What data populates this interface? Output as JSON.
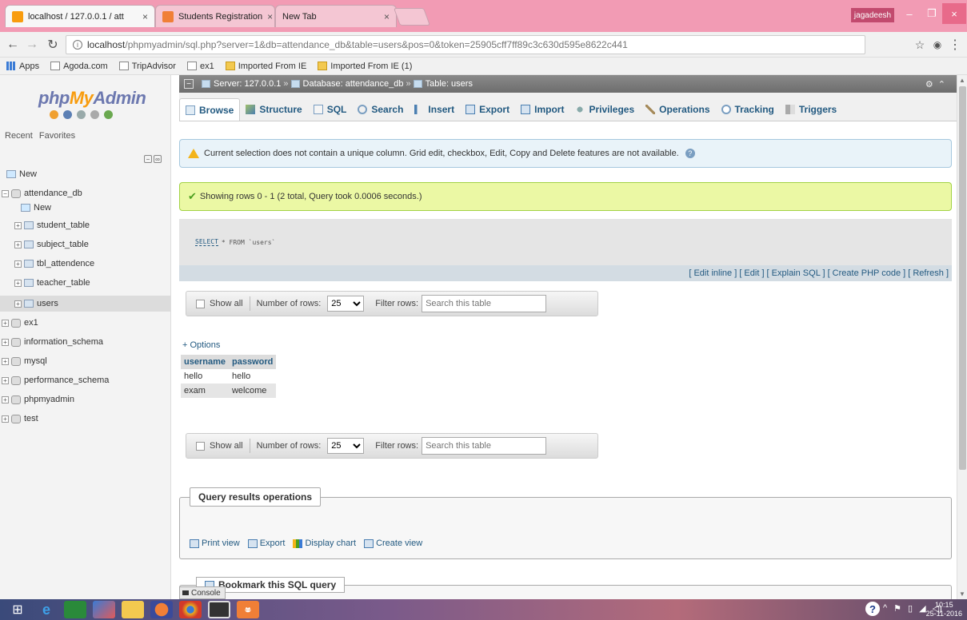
{
  "browser": {
    "tabs": [
      {
        "label": "localhost / 127.0.0.1 / att",
        "close": "×"
      },
      {
        "label": "Students Registration",
        "close": "×"
      },
      {
        "label": "New Tab",
        "close": "×"
      }
    ],
    "user": "jagadeesh",
    "window_controls": {
      "minimize": "–",
      "restore": "❐",
      "close": "×"
    },
    "url_host": "localhost",
    "url_path": "/phpmyadmin/sql.php?server=1&db=attendance_db&table=users&pos=0&token=25905cff7ff89c3c630d595e8622c441",
    "bookmarks": [
      "Apps",
      "Agoda.com",
      "TripAdvisor",
      "ex1",
      "Imported From IE",
      "Imported From IE (1)"
    ]
  },
  "sidebar": {
    "logo_php": "php",
    "logo_my": "My",
    "logo_admin": "Admin",
    "recent": "Recent",
    "favorites": "Favorites",
    "new": "New",
    "databases": [
      {
        "name": "attendance_db",
        "expanded": true
      },
      {
        "name": "ex1"
      },
      {
        "name": "information_schema"
      },
      {
        "name": "mysql"
      },
      {
        "name": "performance_schema"
      },
      {
        "name": "phpmyadmin"
      },
      {
        "name": "test"
      }
    ],
    "attendance_new": "New",
    "tables": [
      "student_table",
      "subject_table",
      "tbl_attendence",
      "teacher_table",
      "users"
    ]
  },
  "breadcrumb": {
    "server_label": "Server: 127.0.0.1",
    "database_label": "Database: attendance_db",
    "table_label": "Table: users"
  },
  "menu_tabs": [
    "Browse",
    "Structure",
    "SQL",
    "Search",
    "Insert",
    "Export",
    "Import",
    "Privileges",
    "Operations",
    "Tracking",
    "Triggers"
  ],
  "notice": "Current selection does not contain a unique column. Grid edit, checkbox, Edit, Copy and Delete features are not available.",
  "success": "Showing rows 0 - 1 (2 total, Query took 0.0006 seconds.)",
  "sql": {
    "keyword": "SELECT",
    "rest": "* FROM `users`"
  },
  "sql_links": "[ Edit inline ] [ Edit ] [ Explain SQL ] [ Create PHP code ] [ Refresh ]",
  "navbar": {
    "show_all": "Show all",
    "rows_label": "Number of rows:",
    "rows_value": "25",
    "filter_label": "Filter rows:",
    "filter_placeholder": "Search this table"
  },
  "options_link": "+ Options",
  "results": {
    "columns": [
      "username",
      "password"
    ],
    "rows": [
      [
        "hello",
        "hello"
      ],
      [
        "exam",
        "welcome"
      ]
    ]
  },
  "query_ops": {
    "legend": "Query results operations",
    "links": [
      "Print view",
      "Export",
      "Display chart",
      "Create view"
    ]
  },
  "bookmark_legend": "Bookmark this SQL query",
  "console": "Console",
  "taskbar": {
    "time": "10:15",
    "date": "25-11-2016"
  },
  "colors": {
    "accent": "#235a81",
    "success_bg": "#ebf8a4",
    "notice_bg": "#e9f3f9",
    "title_pink": "#f29bb4"
  }
}
